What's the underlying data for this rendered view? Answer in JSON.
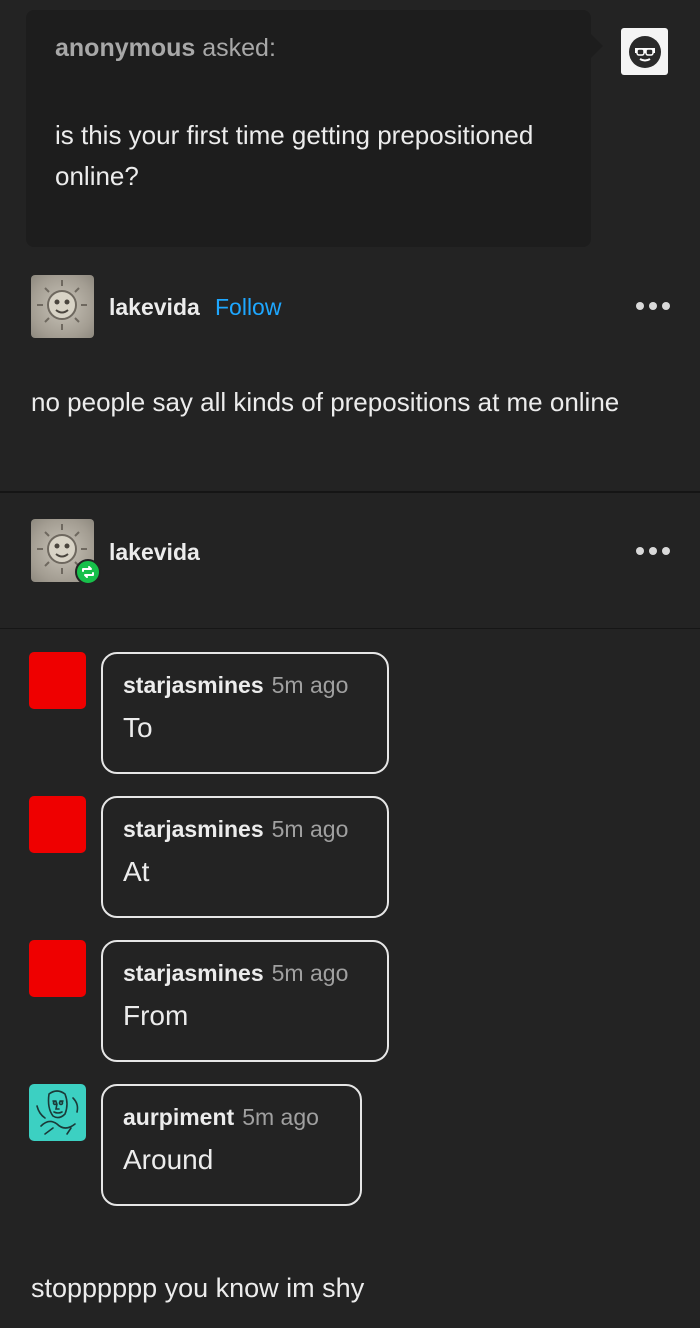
{
  "ask": {
    "asker": "anonymous",
    "asked_label": "asked:",
    "question": "is this your first time getting prepositioned online?"
  },
  "answer_post": {
    "username": "lakevida",
    "follow_label": "Follow",
    "text": "no people say all kinds of prepositions at me online"
  },
  "reblog_post": {
    "username": "lakevida"
  },
  "chat": [
    {
      "user": "starjasmines",
      "time": "5m ago",
      "message": "To",
      "avatar_color": "#ef0000"
    },
    {
      "user": "starjasmines",
      "time": "5m ago",
      "message": "At",
      "avatar_color": "#ef0000"
    },
    {
      "user": "starjasmines",
      "time": "5m ago",
      "message": "From",
      "avatar_color": "#ef0000"
    },
    {
      "user": "aurpiment",
      "time": "5m ago",
      "message": "Around",
      "avatar_color": "#3cd0c2"
    }
  ],
  "final_text": "stopppppp you know im shy",
  "colors": {
    "link": "#1ea7ff",
    "reblog_badge": "#17c04a",
    "background": "#232323"
  }
}
